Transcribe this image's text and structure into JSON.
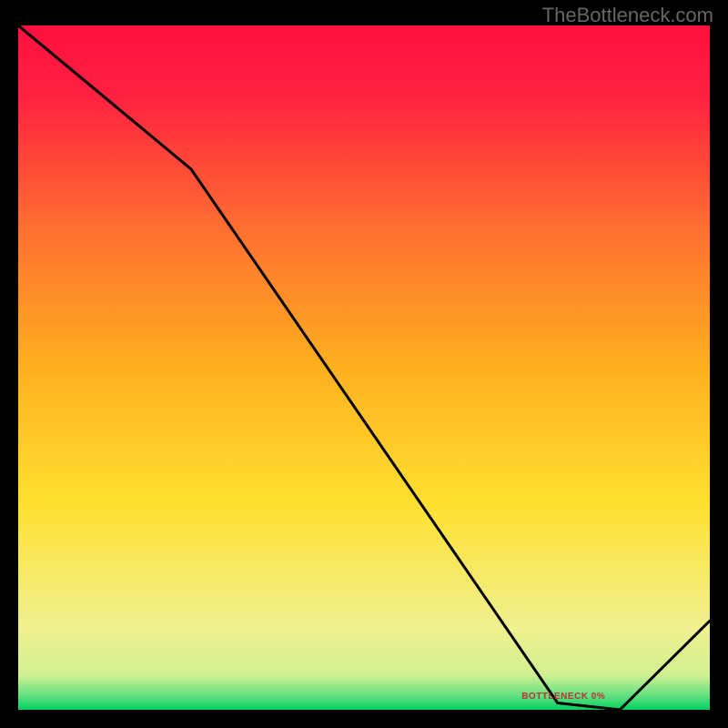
{
  "watermark": "TheBottleneck.com",
  "annotation_label": "BOTTLENECK 0%",
  "chart_data": {
    "type": "line",
    "title": "",
    "xlabel": "",
    "ylabel": "",
    "xlim": [
      0,
      100
    ],
    "ylim": [
      0,
      100
    ],
    "x": [
      0,
      25,
      78,
      87,
      100
    ],
    "y": [
      100,
      79,
      1,
      0,
      13
    ],
    "annotation": {
      "text": "BOTTLENECK 0%",
      "x": 82,
      "y": 1
    },
    "background_gradient": {
      "stops": [
        {
          "pos": 0.0,
          "color": "#00d060"
        },
        {
          "pos": 0.02,
          "color": "#60e080"
        },
        {
          "pos": 0.05,
          "color": "#d0f090"
        },
        {
          "pos": 0.12,
          "color": "#f0f090"
        },
        {
          "pos": 0.3,
          "color": "#ffe030"
        },
        {
          "pos": 0.5,
          "color": "#ffb020"
        },
        {
          "pos": 0.7,
          "color": "#ff7030"
        },
        {
          "pos": 0.9,
          "color": "#ff2040"
        },
        {
          "pos": 1.0,
          "color": "#ff1040"
        }
      ]
    }
  }
}
